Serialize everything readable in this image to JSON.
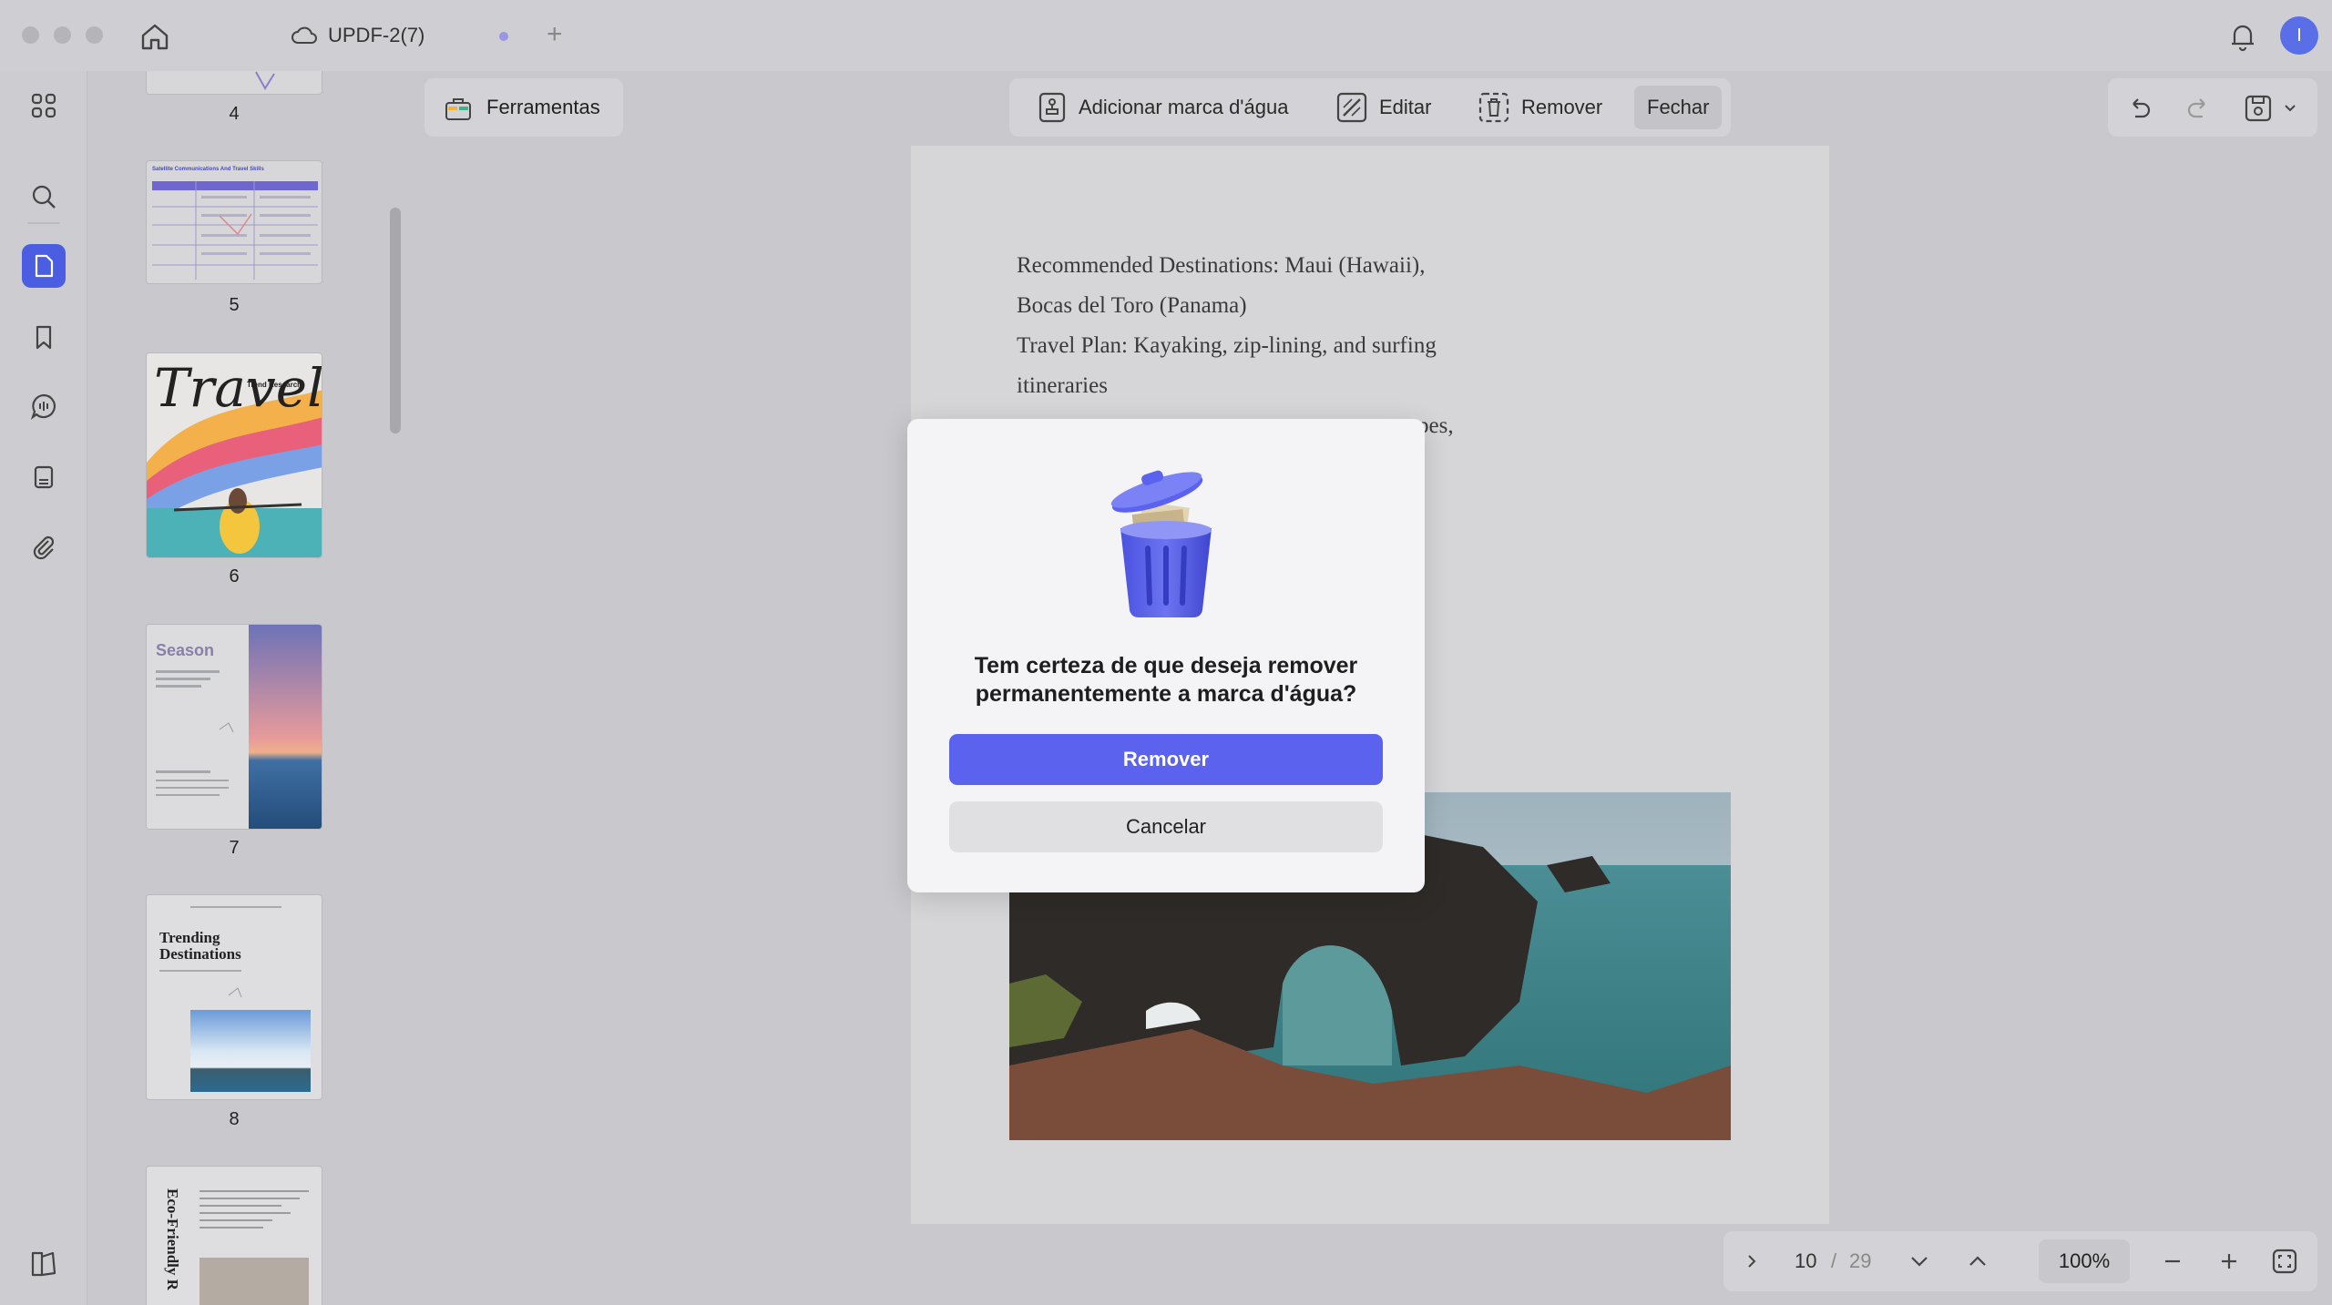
{
  "window": {
    "tab_title": "UPDF-2(7)",
    "new_tab_glyph": "+",
    "avatar_letter": "I"
  },
  "sidebar": {
    "icons": [
      "thumbnails-grid-icon",
      "search-icon",
      "pages-icon",
      "bookmark-icon",
      "comment-icon",
      "form-icon",
      "attachment-icon"
    ]
  },
  "thumbnails": {
    "pages": [
      {
        "num": "4"
      },
      {
        "num": "5",
        "heading": "Satellite Communications And Travel Skills"
      },
      {
        "num": "6",
        "heading": "Travel",
        "sub": "Trend Research"
      },
      {
        "num": "7",
        "heading": "Season"
      },
      {
        "num": "8",
        "heading": "Trending Destinations"
      },
      {
        "num": "",
        "heading": "Eco-Friendly R"
      }
    ]
  },
  "toolbar": {
    "tools_label": "Ferramentas",
    "add_watermark_label": "Adicionar marca d'água",
    "edit_label": "Editar",
    "remove_label": "Remover",
    "close_label": "Fechar"
  },
  "document": {
    "lines": [
      "Recommended Destinations: Maui (Hawaii),",
      "Bocas del Toro (Panama)",
      "Travel Plan: Kayaking, zip-lining, and surfing",
      "itineraries",
      "pes,"
    ]
  },
  "dialog": {
    "message_line1": "Tem certeza de que deseja remover",
    "message_line2": "permanentemente a marca d'água?",
    "confirm_label": "Remover",
    "cancel_label": "Cancelar"
  },
  "pager": {
    "current_page": "10",
    "separator": "/",
    "total_pages": "29",
    "zoom": "100%"
  },
  "colors": {
    "accent": "#5b63ee",
    "rail_active": "#4b5de0"
  }
}
